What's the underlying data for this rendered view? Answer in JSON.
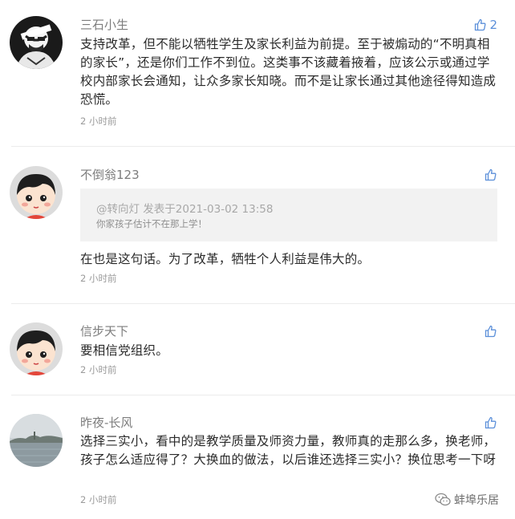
{
  "comments": [
    {
      "author": "三石小生",
      "text": "支持改革，但不能以牺牲学生及家长利益为前提。至于被煽动的“不明真相的家长”，还是你们工作不到位。这类事不该藏着掖着，应该公示或通过学校内部家长会通知，让众多家长知晓。而不是让家长通过其他途径得知造成恐慌。",
      "time": "2 小时前",
      "likes": "2",
      "avatar": "sketch-man-avatar"
    },
    {
      "author": "不倒翁123",
      "quote": {
        "author": "@转向灯  发表于2021-03-02 13:58",
        "text": "你家孩子估计不在那上学！"
      },
      "text": "在也是这句话。为了改革，牺牲个人利益是伟大的。",
      "time": "2 小时前",
      "avatar": "cartoon-girl-avatar"
    },
    {
      "author": "信步天下",
      "text": "要相信党组织。",
      "time": "2 小时前",
      "avatar": "cartoon-girl-avatar"
    },
    {
      "author": "昨夜-长风",
      "text": "选择三实小，看中的是教学质量及师资力量，教师真的走那么多，换老师，孩子怎么适应得了？大换血的做法，以后谁还选择三实小？换位思考一下呀",
      "time": "2 小时前",
      "avatar": "lake-photo-avatar"
    }
  ],
  "watermark": {
    "text": "蚌埠乐居",
    "icon": "wechat-icon"
  },
  "colors": {
    "accent": "#5b8fd9",
    "name": "#7d7d7d",
    "time": "#9a9a9a",
    "quote_bg": "#f2f2f2"
  }
}
